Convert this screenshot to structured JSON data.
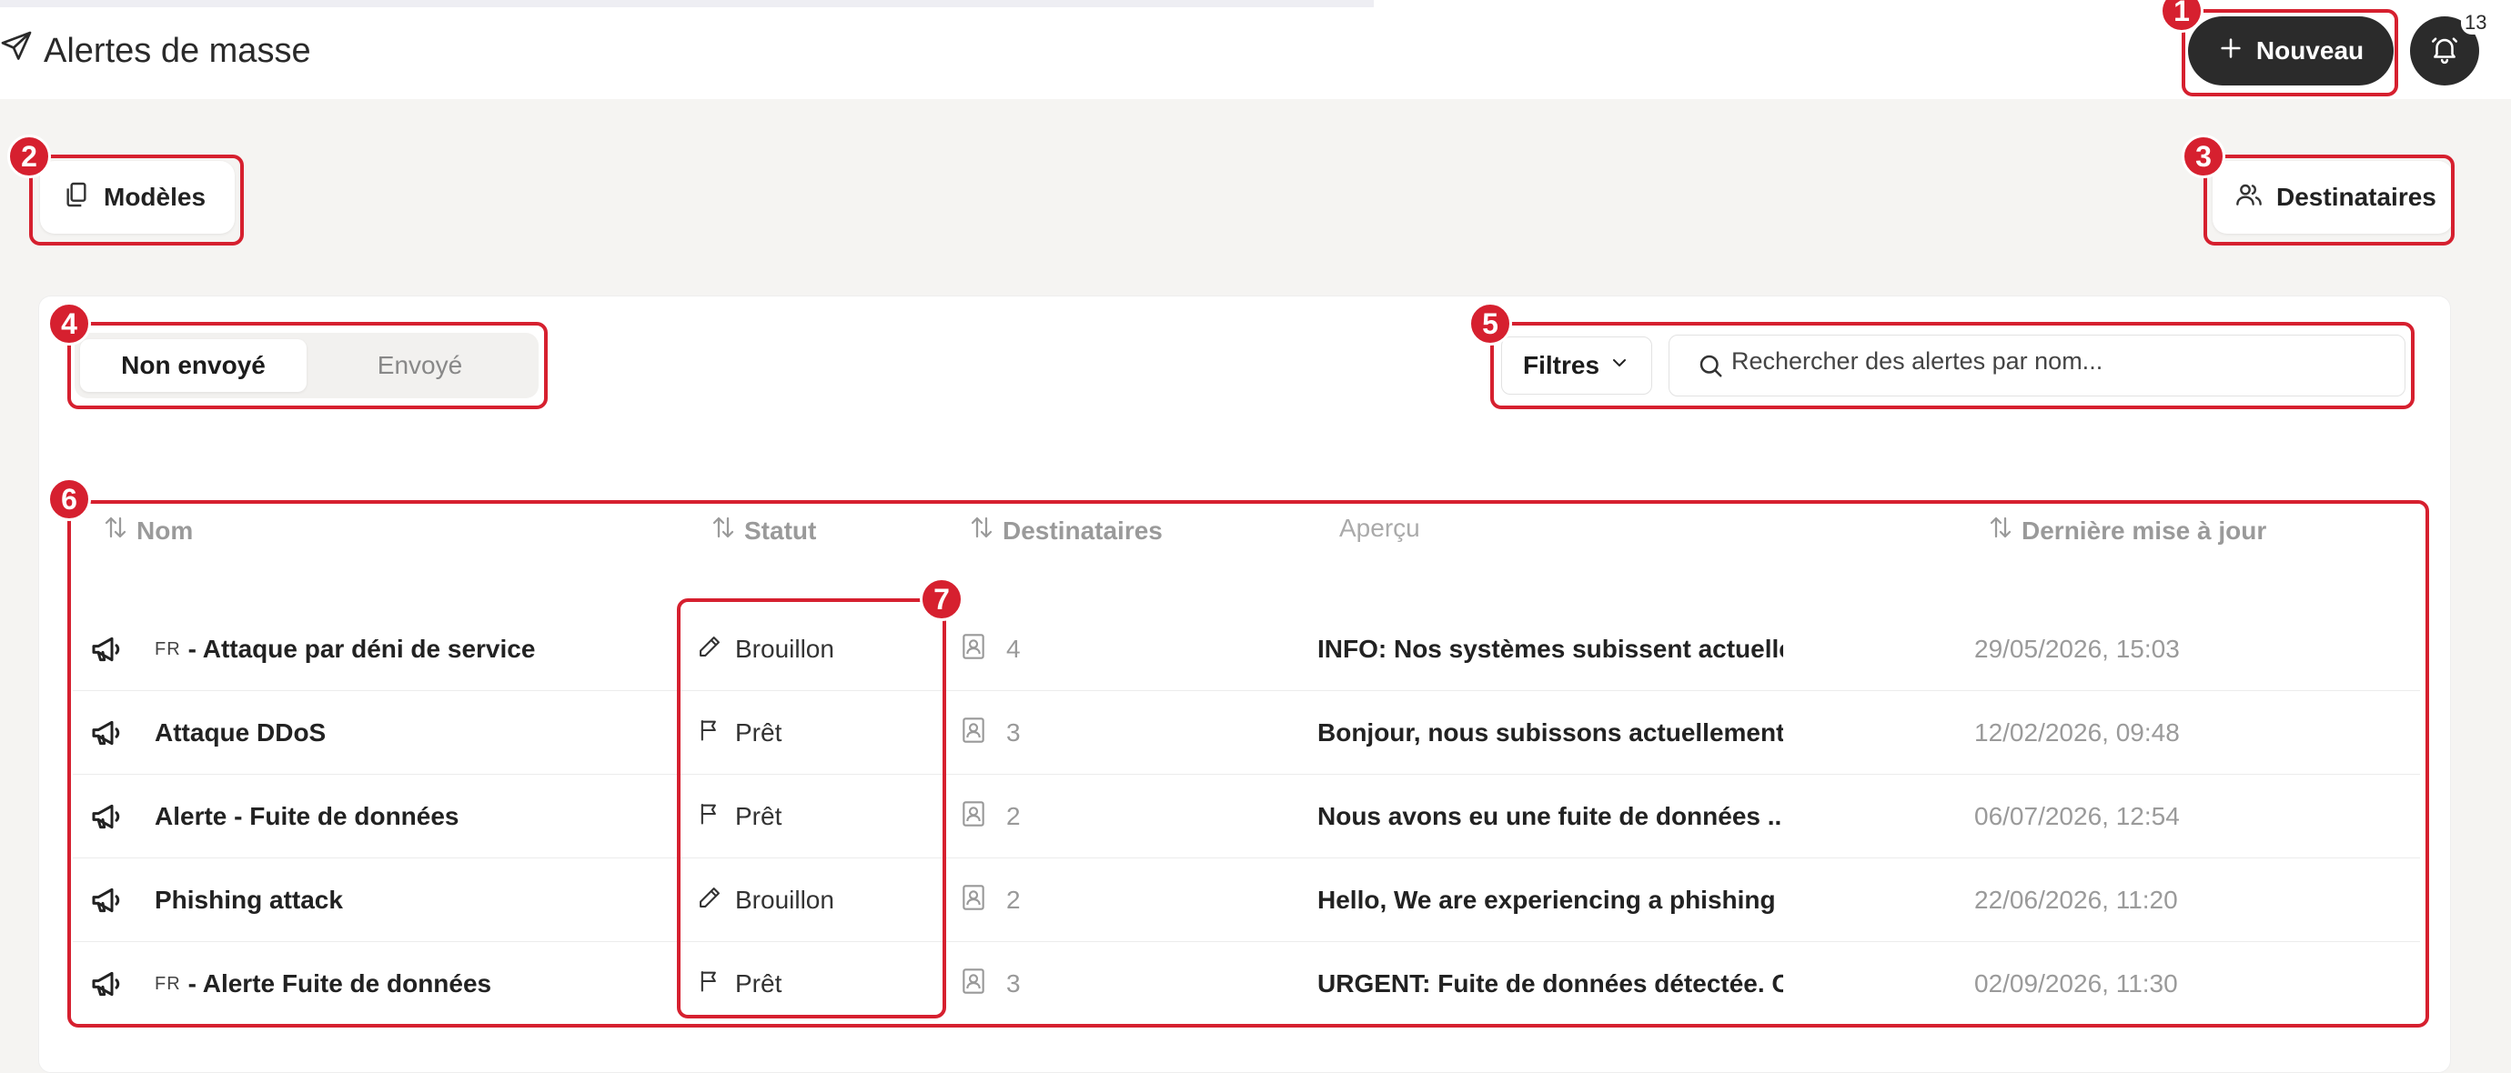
{
  "header": {
    "title": "Alertes de masse",
    "new_button_label": "Nouveau",
    "notification_count": "13"
  },
  "toolbar": {
    "templates_label": "Modèles",
    "recipients_label": "Destinataires"
  },
  "tabs": [
    {
      "label": "Non envoyé",
      "active": true
    },
    {
      "label": "Envoyé",
      "active": false
    }
  ],
  "filters": {
    "label": "Filtres",
    "search_placeholder": "Rechercher des alertes par nom..."
  },
  "table": {
    "columns": {
      "name": "Nom",
      "status": "Statut",
      "recipients": "Destinataires",
      "preview": "Aperçu",
      "updated": "Dernière mise à jour"
    },
    "rows": [
      {
        "lang": "FR",
        "name": "- Attaque par déni de service",
        "status": "Brouillon",
        "status_icon": "pencil-icon",
        "recipients": "4",
        "preview": "INFO: Nos systèmes subissent actuellement",
        "updated": "29/05/2026, 15:03"
      },
      {
        "lang": "",
        "name": "Attaque DDoS",
        "status": "Prêt",
        "status_icon": "flag-icon",
        "recipients": "3",
        "preview": "Bonjour, nous subissons actuellement une",
        "updated": "12/02/2026, 09:48"
      },
      {
        "lang": "",
        "name": "Alerte - Fuite de données",
        "status": "Prêt",
        "status_icon": "flag-icon",
        "recipients": "2",
        "preview": "Nous avons eu une fuite de données ...",
        "updated": "06/07/2026, 12:54"
      },
      {
        "lang": "",
        "name": "Phishing attack",
        "status": "Brouillon",
        "status_icon": "pencil-icon",
        "recipients": "2",
        "preview": "Hello, We are experiencing a phishing attack",
        "updated": "22/06/2026, 11:20"
      },
      {
        "lang": "FR",
        "name": "- Alerte Fuite de données",
        "status": "Prêt",
        "status_icon": "flag-icon",
        "recipients": "3",
        "preview": "URGENT: Fuite de données détectée. Chaque",
        "updated": "02/09/2026, 11:30"
      }
    ]
  },
  "annotations": [
    "1",
    "2",
    "3",
    "4",
    "5",
    "6",
    "7"
  ],
  "colors": {
    "annotation": "#d6202f",
    "primary_button": "#2b2b2b",
    "background": "#f5f4f2"
  }
}
